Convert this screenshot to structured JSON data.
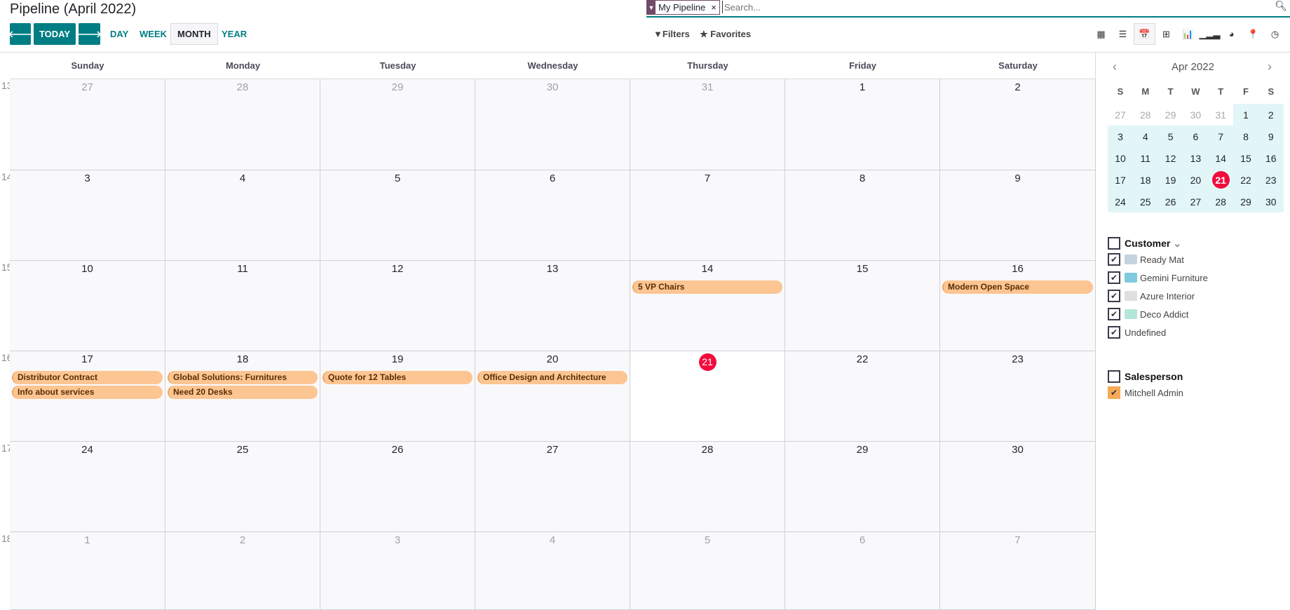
{
  "header": {
    "title": "Pipeline (April 2022)",
    "today_label": "TODAY",
    "prev_icon": "arrow-left-icon",
    "next_icon": "arrow-right-icon",
    "scales": [
      {
        "label": "DAY",
        "active": false
      },
      {
        "label": "WEEK",
        "active": false
      },
      {
        "label": "MONTH",
        "active": true
      },
      {
        "label": "YEAR",
        "active": false
      }
    ]
  },
  "search": {
    "facet": "My Pipeline",
    "placeholder": "Search...",
    "filters_label": "Filters",
    "favorites_label": "Favorites"
  },
  "views": [
    {
      "icon": "kanban-icon",
      "glyph": "▦",
      "active": false
    },
    {
      "icon": "list-icon",
      "glyph": "☰",
      "active": false
    },
    {
      "icon": "calendar-icon",
      "glyph": "📅",
      "active": true
    },
    {
      "icon": "pivot-icon",
      "glyph": "⊞",
      "active": false
    },
    {
      "icon": "graph-icon",
      "glyph": "📊",
      "active": false
    },
    {
      "icon": "cohort-icon",
      "glyph": "▁▂▃",
      "active": false
    },
    {
      "icon": "dashboard-icon",
      "glyph": "◕",
      "active": false
    },
    {
      "icon": "map-icon",
      "glyph": "📍",
      "active": false
    },
    {
      "icon": "activity-icon",
      "glyph": "◷",
      "active": false
    }
  ],
  "calendar": {
    "weekdays": [
      "Sunday",
      "Monday",
      "Tuesday",
      "Wednesday",
      "Thursday",
      "Friday",
      "Saturday"
    ],
    "weeks": [
      {
        "week": "13",
        "days": [
          {
            "d": "27",
            "m": true
          },
          {
            "d": "28",
            "m": true
          },
          {
            "d": "29",
            "m": true
          },
          {
            "d": "30",
            "m": true
          },
          {
            "d": "31",
            "m": true
          },
          {
            "d": "1"
          },
          {
            "d": "2"
          }
        ]
      },
      {
        "week": "14",
        "days": [
          {
            "d": "3"
          },
          {
            "d": "4"
          },
          {
            "d": "5"
          },
          {
            "d": "6"
          },
          {
            "d": "7"
          },
          {
            "d": "8"
          },
          {
            "d": "9"
          }
        ]
      },
      {
        "week": "15",
        "days": [
          {
            "d": "10"
          },
          {
            "d": "11"
          },
          {
            "d": "12"
          },
          {
            "d": "13"
          },
          {
            "d": "14",
            "events": [
              "5 VP Chairs"
            ]
          },
          {
            "d": "15"
          },
          {
            "d": "16",
            "events": [
              "Modern Open Space"
            ]
          }
        ]
      },
      {
        "week": "16",
        "days": [
          {
            "d": "17",
            "events": [
              "Distributor Contract",
              "Info about services"
            ]
          },
          {
            "d": "18",
            "events": [
              "Global Solutions: Furnitures",
              "Need 20 Desks"
            ]
          },
          {
            "d": "19",
            "events": [
              "Quote for 12 Tables"
            ]
          },
          {
            "d": "20",
            "events": [
              "Office Design and Architecture"
            ]
          },
          {
            "d": "21",
            "today": true
          },
          {
            "d": "22"
          },
          {
            "d": "23"
          }
        ]
      },
      {
        "week": "17",
        "days": [
          {
            "d": "24"
          },
          {
            "d": "25"
          },
          {
            "d": "26"
          },
          {
            "d": "27"
          },
          {
            "d": "28"
          },
          {
            "d": "29"
          },
          {
            "d": "30"
          }
        ]
      },
      {
        "week": "18",
        "days": [
          {
            "d": "1",
            "m": true
          },
          {
            "d": "2",
            "m": true
          },
          {
            "d": "3",
            "m": true
          },
          {
            "d": "4",
            "m": true
          },
          {
            "d": "5",
            "m": true
          },
          {
            "d": "6",
            "m": true
          },
          {
            "d": "7",
            "m": true
          }
        ]
      }
    ],
    "event_color": "#fcc591",
    "today_color": "#f30b3c"
  },
  "mini": {
    "title": "Apr 2022",
    "letters": [
      "S",
      "M",
      "T",
      "W",
      "T",
      "F",
      "S"
    ],
    "rows": [
      [
        "27",
        "28",
        "29",
        "30",
        "31",
        "1",
        "2"
      ],
      [
        "3",
        "4",
        "5",
        "6",
        "7",
        "8",
        "9"
      ],
      [
        "10",
        "11",
        "12",
        "13",
        "14",
        "15",
        "16"
      ],
      [
        "17",
        "18",
        "19",
        "20",
        "21",
        "22",
        "23"
      ],
      [
        "24",
        "25",
        "26",
        "27",
        "28",
        "29",
        "30"
      ]
    ],
    "today": "21"
  },
  "filters": {
    "customer": {
      "label": "Customer",
      "items": [
        {
          "label": "Ready Mat",
          "logo": "#9fb4cc"
        },
        {
          "label": "Gemini Furniture",
          "logo": "#2aa7c4"
        },
        {
          "label": "Azure Interior",
          "logo": "#c9c9c9"
        },
        {
          "label": "Deco Addict",
          "logo": "#7fd6c0"
        },
        {
          "label": "Undefined"
        }
      ]
    },
    "salesperson": {
      "label": "Salesperson",
      "items": [
        {
          "label": "Mitchell Admin"
        }
      ]
    }
  }
}
